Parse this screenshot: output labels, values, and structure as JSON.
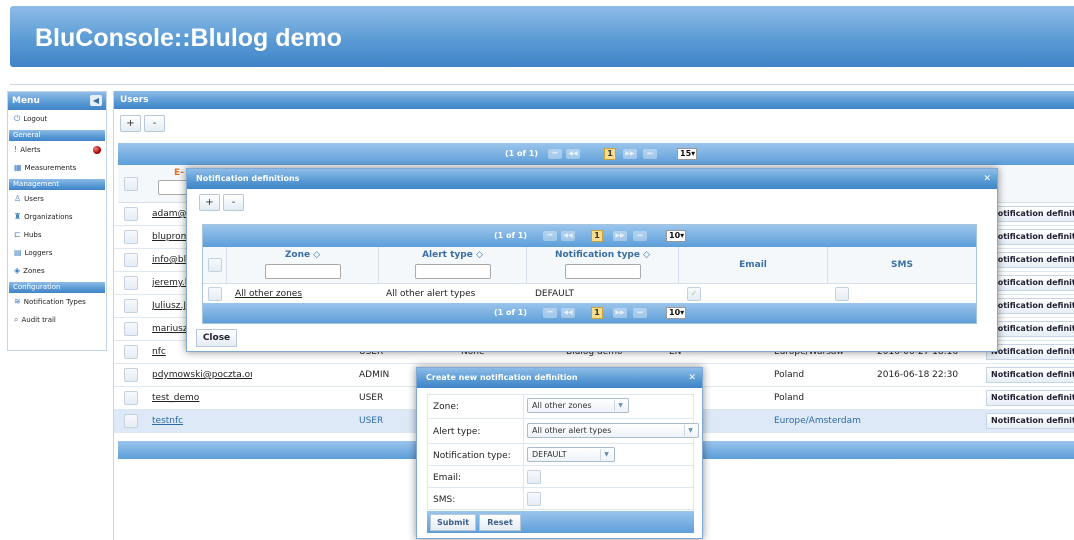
{
  "app": {
    "title": "BluConsole::Blulog demo"
  },
  "menu": {
    "title": "Menu",
    "collapse_icon": "chevron-left-icon",
    "logout": "Logout",
    "sections": [
      {
        "title": "General",
        "items": [
          "Alerts",
          "Measurements"
        ]
      },
      {
        "title": "Management",
        "items": [
          "Users",
          "Organizations",
          "Hubs",
          "Loggers",
          "Zones"
        ]
      },
      {
        "title": "Configuration",
        "items": [
          "Notification Types",
          "Audit trail"
        ]
      }
    ]
  },
  "users": {
    "title": "Users",
    "add": "+",
    "remove": "-",
    "pager": {
      "text": "(1 of 1)",
      "page": "1",
      "per_page": "15"
    },
    "column_email": "E-",
    "rows": [
      {
        "email": "adam@a"
      },
      {
        "email": "blupromo"
      },
      {
        "email": "info@blu"
      },
      {
        "email": "jeremy.la"
      },
      {
        "email": "Juliusz.J"
      },
      {
        "email": "mariuszp"
      },
      {
        "email": "nfc",
        "role": "USER",
        "col3": "None",
        "org": "Blulog demo",
        "lang": "EN",
        "tz": "Europe/Warsaw",
        "date": "2016-06-27 18:16"
      },
      {
        "email": "pdymowski@poczta.onet",
        "role": "ADMIN",
        "tz": "Poland",
        "date": "2016-06-18 22:30"
      },
      {
        "email": "test_demo",
        "role": "USER",
        "tz": "Poland"
      },
      {
        "email": "testnfc",
        "role": "USER",
        "tz": "Europe/Amsterdam"
      }
    ],
    "row_button": "Notification definit"
  },
  "notif_defs": {
    "title": "Notification definitions",
    "add": "+",
    "remove": "-",
    "pager": {
      "text": "(1 of 1)",
      "page": "1",
      "per_page": "10"
    },
    "columns": {
      "zone": "Zone ◇",
      "alert_type": "Alert type ◇",
      "notification_type": "Notification type ◇",
      "email": "Email",
      "sms": "SMS"
    },
    "row": {
      "zone": "All other zones",
      "alert_type": "All other alert types",
      "notification_type": "DEFAULT"
    },
    "close": "Close"
  },
  "create": {
    "title": "Create new notification definition",
    "zone_label": "Zone:",
    "zone_value": "All other zones",
    "alert_label": "Alert type:",
    "alert_value": "All other alert types",
    "ntype_label": "Notification type:",
    "ntype_value": "DEFAULT",
    "email_label": "Email:",
    "sms_label": "SMS:",
    "submit": "Submit",
    "reset": "Reset"
  }
}
